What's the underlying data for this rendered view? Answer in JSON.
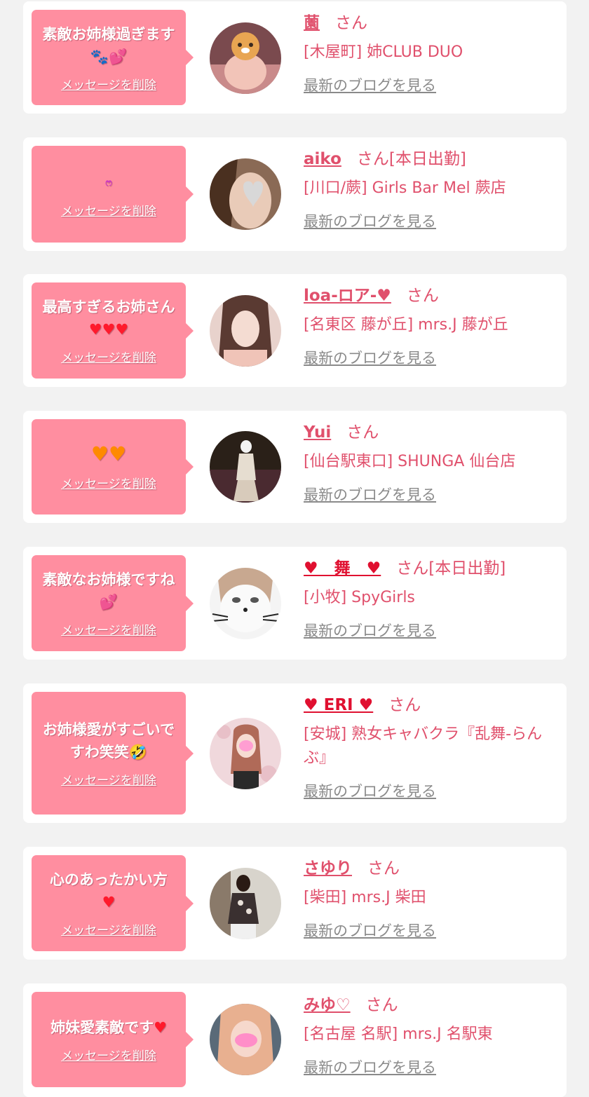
{
  "delete_label": "メッセージを削除",
  "san_label": "さん",
  "blog_label": "最新のブログを見る",
  "colors": {
    "accent": "#e0506c",
    "bubble": "#ff8ea0",
    "background": "#f2f2f2"
  },
  "cards": [
    {
      "message": "素敵お姉様過ぎます",
      "message_emoji": "🐾💕",
      "name": "薗",
      "status": "",
      "shop": "[木屋町] 姉CLUB DUO"
    },
    {
      "message": "",
      "message_emoji": "ෆ",
      "name": "aiko",
      "status": "[本日出勤]",
      "shop": "[川口/蕨] Girls Bar Mel 蕨店"
    },
    {
      "message": "最高すぎるお姉さん",
      "message_emoji": "♥♥♥",
      "name": "loa-ロア-♥",
      "status": "",
      "shop": "[名東区 藤が丘] mrs.J 藤が丘"
    },
    {
      "message": "",
      "message_emoji": "♥♥",
      "name": "Yui",
      "status": "",
      "shop": "[仙台駅東口] SHUNGA 仙台店"
    },
    {
      "message": "素敵なお姉様ですね",
      "message_emoji": "💕",
      "name": "♥　舞　♥",
      "status": "[本日出勤]",
      "shop": "[小牧] SpyGirls"
    },
    {
      "message": "お姉様愛がすごいですわ笑笑",
      "message_emoji": "🤣",
      "name": "♥ ERI ♥",
      "status": "",
      "shop": "[安城] 熟女キャバクラ『乱舞-らんぶ』"
    },
    {
      "message": "心のあったかい方",
      "message_emoji": "♥",
      "name": "さゆり",
      "status": "",
      "shop": "[柴田] mrs.J 柴田"
    },
    {
      "message": "姉妹愛素敵です",
      "message_emoji": "♥",
      "name": "みゆ♡",
      "status": "",
      "shop": "[名古屋 名駅] mrs.J 名駅東"
    }
  ]
}
